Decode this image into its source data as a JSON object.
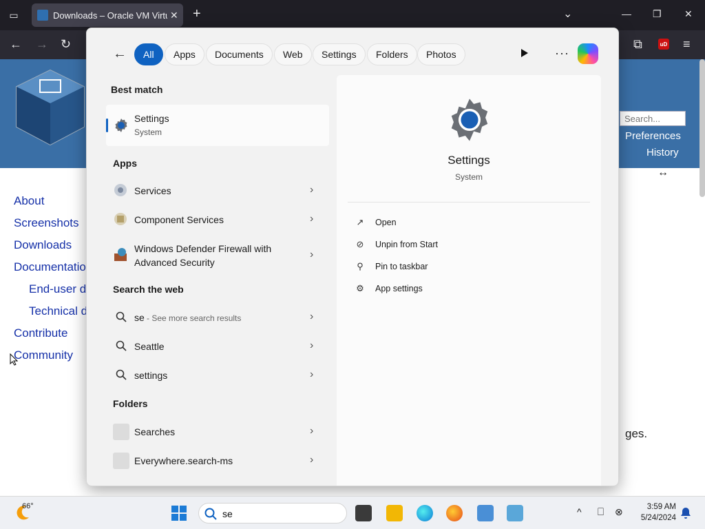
{
  "browser": {
    "tab_title": "Downloads – Oracle VM VirtualBox",
    "tab_close": "✕",
    "new_tab": "+",
    "list_all_tabs": "▭",
    "minimize": "—",
    "restore": "❐",
    "close": "✕",
    "chevron": "⌄",
    "back": "←",
    "forward": "→",
    "reload": "↻",
    "extensions": "⧉",
    "menu": "≡",
    "ublock": "uD"
  },
  "page": {
    "sidebar_links": [
      "About",
      "Screenshots",
      "Downloads",
      "Documentation",
      "End-user d",
      "Technical d",
      "Contribute",
      "Community"
    ],
    "search_placeholder": "Search...",
    "preferences": "Preferences",
    "history": "History",
    "resize": "↔",
    "trailing_text": "ges."
  },
  "start": {
    "filters": [
      "All",
      "Apps",
      "Documents",
      "Web",
      "Settings",
      "Folders",
      "Photos"
    ],
    "best_match_title": "Best match",
    "best_match": {
      "name": "Settings",
      "type": "System"
    },
    "apps_title": "Apps",
    "apps": [
      {
        "name": "Services"
      },
      {
        "name": "Component Services"
      },
      {
        "name_line1": "Windows Defender Firewall with",
        "name_line2": "Advanced Security"
      }
    ],
    "web_title": "Search the web",
    "web": [
      {
        "term": "se",
        "hint": " - See more search results"
      },
      {
        "term": "Seattle"
      },
      {
        "term": "settings"
      }
    ],
    "folders_title": "Folders",
    "folders": [
      {
        "name": "Searches"
      },
      {
        "name": "Everywhere.search-ms"
      }
    ],
    "detail": {
      "name": "Settings",
      "type": "System",
      "actions": [
        "Open",
        "Unpin from Start",
        "Pin to taskbar",
        "App settings"
      ]
    },
    "back": "←",
    "more": "···",
    "chevron": "›"
  },
  "taskbar": {
    "temperature": "66°",
    "search_value": "se",
    "time": "3:59 AM",
    "date": "5/24/2024",
    "up_arrow": "^"
  },
  "colors": {
    "accent": "#0f62c1",
    "tab_bg": "#42414d",
    "titlebar": "#1f1e25"
  }
}
